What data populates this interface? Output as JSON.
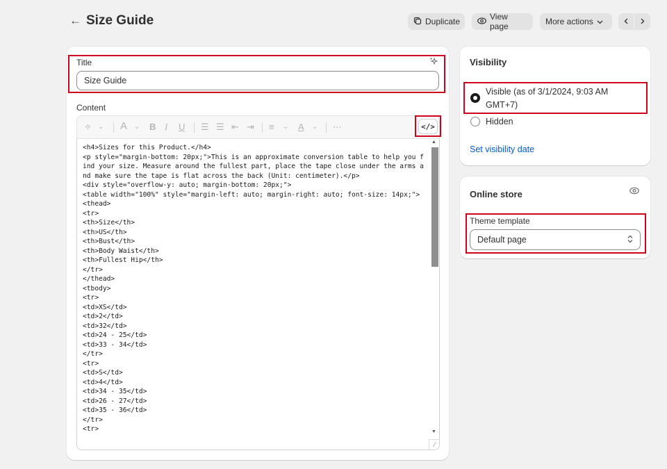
{
  "header": {
    "title": "Size Guide",
    "buttons": {
      "duplicate": "Duplicate",
      "view_page": "View page",
      "more_actions": "More actions"
    }
  },
  "main": {
    "title_label": "Title",
    "title_value": "Size Guide",
    "content_label": "Content",
    "code_lines": [
      "<h4>Sizes for this Product.</h4>",
      "<p style=\"margin-bottom: 20px;\">This is an approximate conversion table to help you find your size. Measure around the fullest part, place the tape close under the arms and make sure the tape is flat across the back (Unit: centimeter).</p>",
      "<div style=\"overflow-y: auto; margin-bottom: 20px;\">",
      "<table width=\"100%\" style=\"margin-left: auto; margin-right: auto; font-size: 14px;\">",
      "<thead>",
      "<tr>",
      "<th>Size</th>",
      "<th>US</th>",
      "<th>Bust</th>",
      "<th>Body Waist</th>",
      "<th>Fullest Hip</th>",
      "</tr>",
      "</thead>",
      "<tbody>",
      "<tr>",
      "<td>XS</td>",
      "<td>2</td>",
      "<td>32</td>",
      "<td>24 - 25</td>",
      "<td>33 - 34</td>",
      "</tr>",
      "<tr>",
      "<td>S</td>",
      "<td>4</td>",
      "<td>34 - 35</td>",
      "<td>26 - 27</td>",
      "<td>35 - 36</td>",
      "</tr>",
      "<tr>"
    ]
  },
  "visibility": {
    "title": "Visibility",
    "options": [
      {
        "label": "Visible (as of 3/1/2024, 9:03 AM GMT+7)",
        "selected": true
      },
      {
        "label": "Hidden",
        "selected": false
      }
    ],
    "set_date_link": "Set visibility date"
  },
  "online_store": {
    "title": "Online store",
    "theme_template_label": "Theme template",
    "theme_template_value": "Default page"
  },
  "colors": {
    "highlight": "#d0021b",
    "link": "#005bd3",
    "background": "#f1f1f1"
  }
}
